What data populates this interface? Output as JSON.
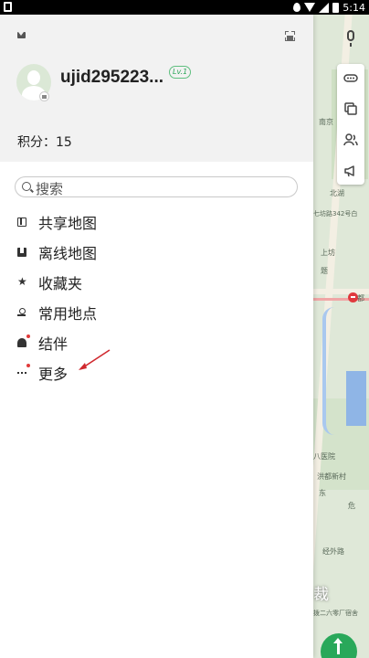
{
  "status_bar": {
    "time": "5:14"
  },
  "user": {
    "name": "ujid295223...",
    "level": "Lv.1",
    "points": "积分：15"
  },
  "search": {
    "placeholder": "搜索"
  },
  "menu": [
    {
      "label": "共享地图",
      "icon": "shared-map-icon"
    },
    {
      "label": "离线地图",
      "icon": "offline-map-icon"
    },
    {
      "label": "收藏夹",
      "icon": "star-icon"
    },
    {
      "label": "常用地点",
      "icon": "place-icon"
    },
    {
      "label": "结伴",
      "icon": "partner-icon",
      "dot": true
    },
    {
      "label": "更多",
      "icon": "more-icon",
      "dot": true
    }
  ],
  "map": {
    "labels": [
      "南京",
      "北湖",
      "七坊路342号白",
      "上坊",
      "题",
      "都",
      "八医院",
      "洪都新村",
      "东",
      "危",
      "经外路",
      "拨二六零厂宿舍"
    ],
    "big_label": "裁"
  },
  "colors": {
    "accent": "#29a85a",
    "dot": "#e03a3a",
    "metro": "#e0393e",
    "annotation": "#d0282e"
  }
}
